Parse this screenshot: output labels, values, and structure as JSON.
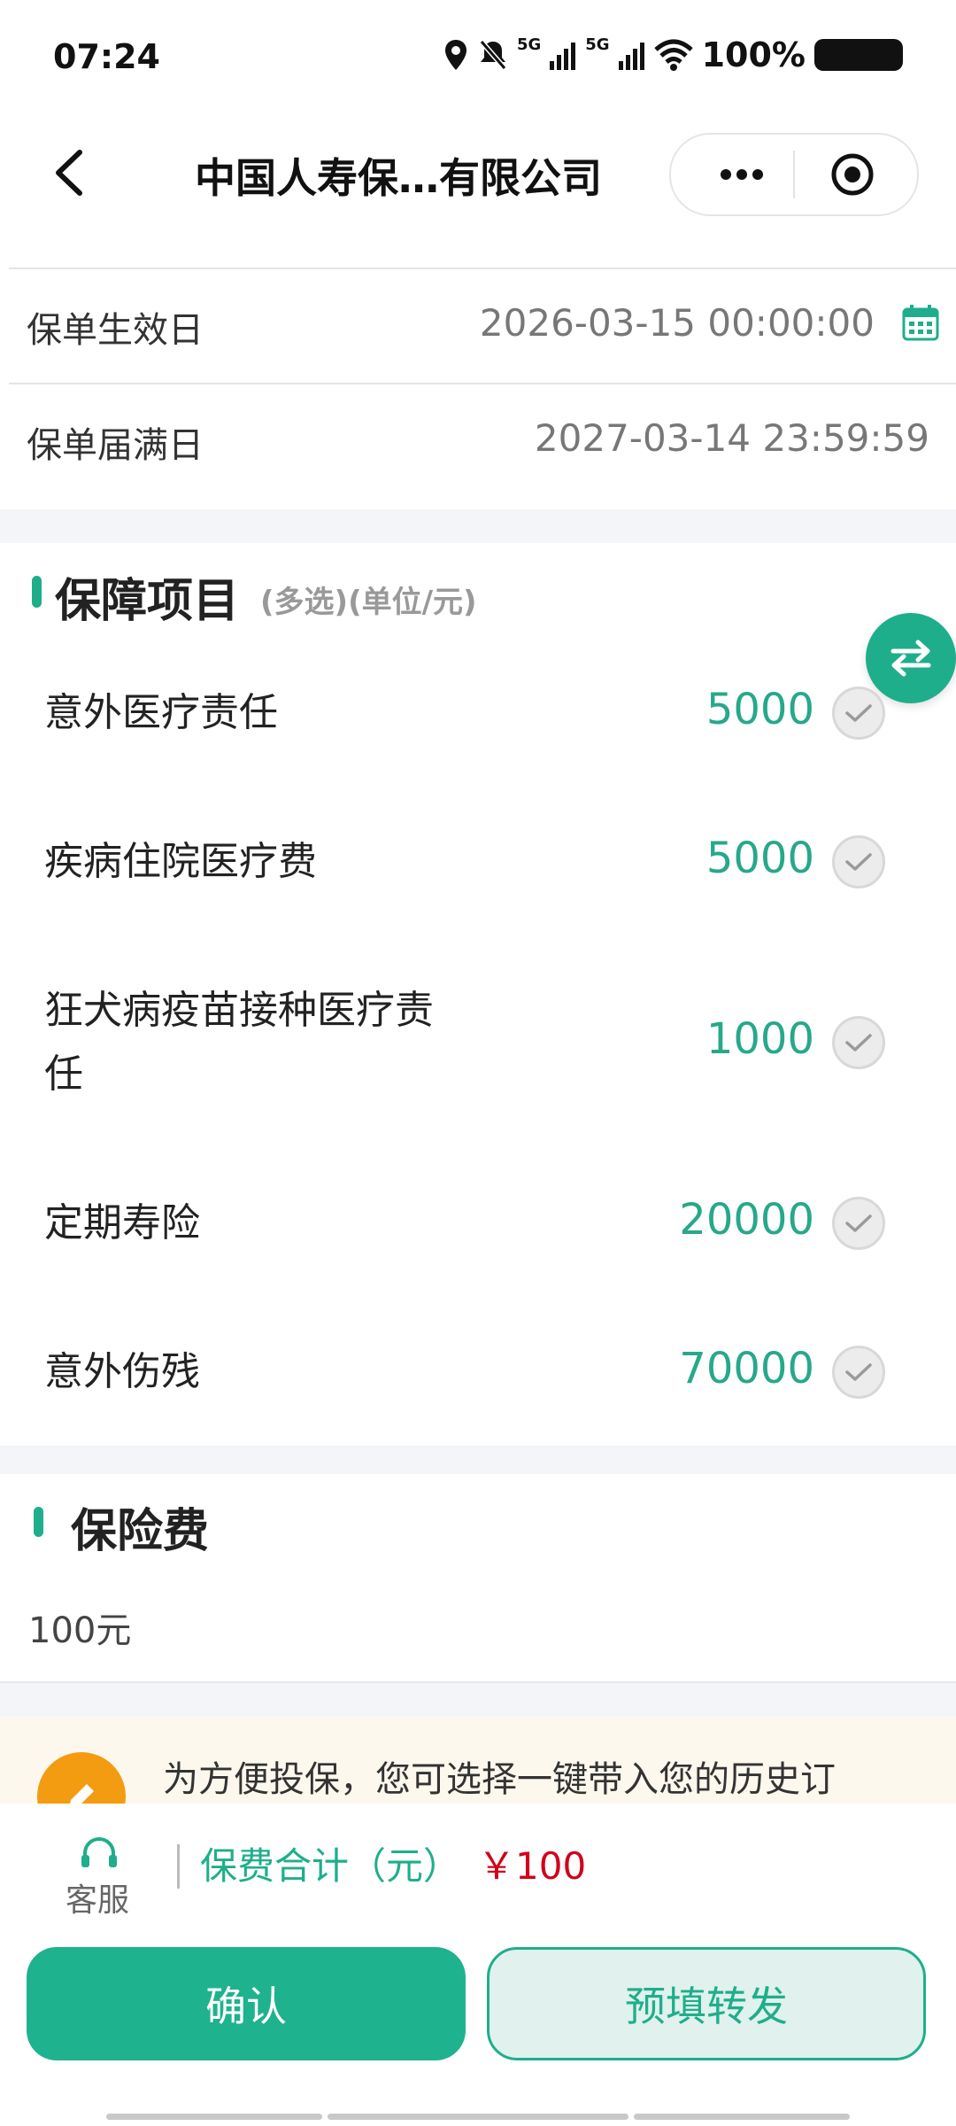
{
  "status": {
    "time": "07:24",
    "network_a": "5G",
    "network_b": "5G",
    "battery": "100%"
  },
  "nav": {
    "title": "中国人寿保…有限公司",
    "more_icon": "more-dots-icon",
    "close_icon": "target-icon"
  },
  "policy": {
    "start_label": "保单生效日",
    "start_value": "2026-03-15 00:00:00",
    "end_label": "保单届满日",
    "end_value": "2027-03-14 23:59:59"
  },
  "coverage": {
    "title": "保障项目",
    "subtitle": "(多选)(单位/元)",
    "items": [
      {
        "label": "意外医疗责任",
        "value": "5000"
      },
      {
        "label": "疾病住院医疗费",
        "value": "5000"
      },
      {
        "label": "狂犬病疫苗接种医疗责",
        "label_line2": "任",
        "value": "1000"
      },
      {
        "label": "定期寿险",
        "value": "20000"
      },
      {
        "label": "意外伤残",
        "value": "70000"
      }
    ]
  },
  "premium": {
    "title": "保险费",
    "value": "100元"
  },
  "notice": {
    "text": "为方便投保，您可选择一键带入您的历史订"
  },
  "bottom": {
    "service_label": "客服",
    "total_label": "保费合计（元）",
    "total_value": "￥100",
    "confirm_label": "确认",
    "prefill_label": "预填转发"
  },
  "colors": {
    "accent": "#1fae8b",
    "price": "#d0021b",
    "notice_bg": "#fdf8ee",
    "notice_icon": "#f39c12"
  }
}
